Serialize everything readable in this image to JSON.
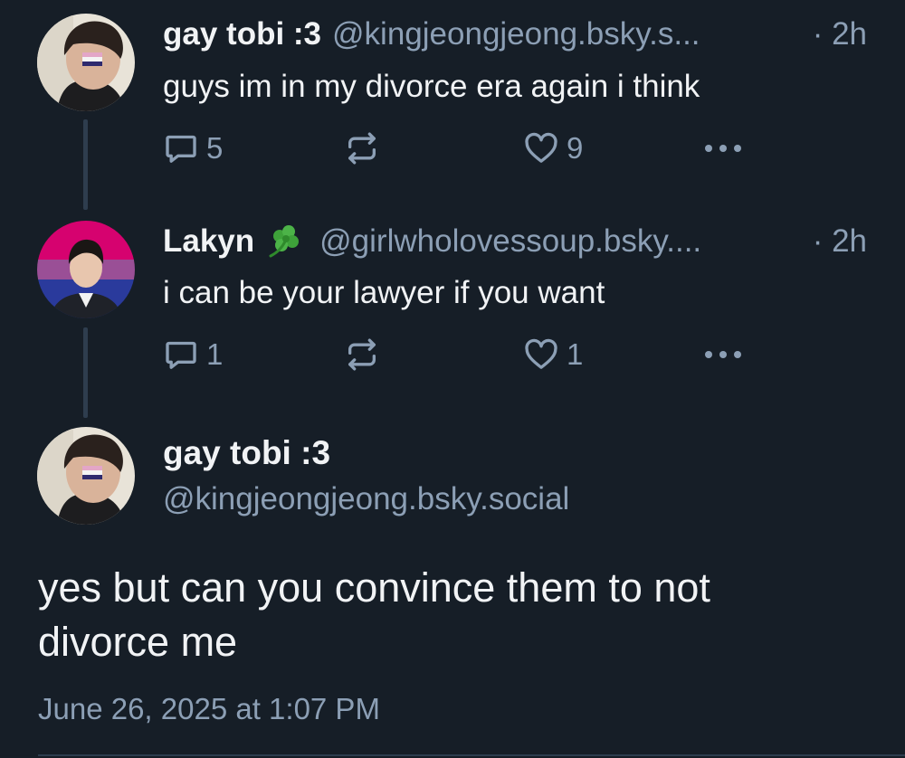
{
  "posts": [
    {
      "display_name": "gay tobi :3",
      "handle": "@kingjeongjeong.bsky.s...",
      "time": "· 2h",
      "text": "guys im in my divorce era again i think",
      "reply_count": "5",
      "like_count": "9"
    },
    {
      "display_name": "Lakyn",
      "emoji": "shamrock",
      "handle": "@girlwholovessoup.bsky....",
      "time": "· 2h",
      "text": "i can be your lawyer if you want",
      "reply_count": "1",
      "like_count": "1"
    }
  ],
  "main_post": {
    "display_name": "gay tobi :3",
    "handle": "@kingjeongjeong.bsky.social",
    "text": "yes but can you convince them to not divorce me",
    "timestamp": "June 26, 2025 at 1:07 PM"
  },
  "icons": {
    "reply": "reply-icon",
    "repost": "repost-icon",
    "like": "like-icon",
    "more": "more-icon"
  },
  "colors": {
    "background": "#161e27",
    "text": "#f1f3f5",
    "muted": "#8c9fb5",
    "thread_line": "#2e3d4e"
  }
}
